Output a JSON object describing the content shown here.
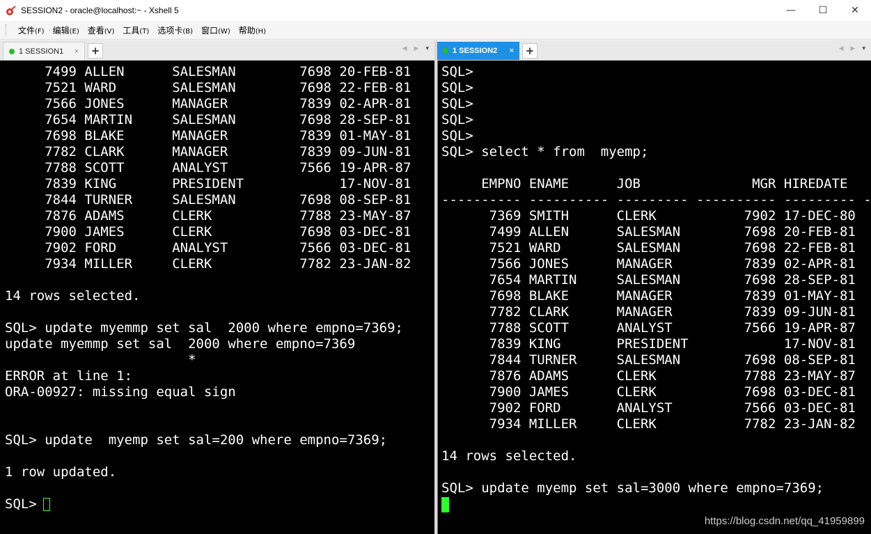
{
  "window": {
    "title": "SESSION2 - oracle@localhost:~ - Xshell 5",
    "minimize": "—",
    "maximize": "☐",
    "close": "✕"
  },
  "menu": [
    {
      "label": "文件",
      "accel": "(F)"
    },
    {
      "label": "编辑",
      "accel": "(E)"
    },
    {
      "label": "查看",
      "accel": "(V)"
    },
    {
      "label": "工具",
      "accel": "(T)"
    },
    {
      "label": "选项卡",
      "accel": "(B)"
    },
    {
      "label": "窗口",
      "accel": "(W)"
    },
    {
      "label": "帮助",
      "accel": "(H)"
    }
  ],
  "left_pane": {
    "tab_label": "1 SESSION1",
    "tab_close": "×",
    "add_tab": "+",
    "nav_prev": "◀",
    "nav_next": "▶",
    "nav_dropdown": "▾",
    "lines": [
      "     7499 ALLEN      SALESMAN        7698 20-FEB-81",
      "     7521 WARD       SALESMAN        7698 22-FEB-81",
      "     7566 JONES      MANAGER         7839 02-APR-81",
      "     7654 MARTIN     SALESMAN        7698 28-SEP-81",
      "     7698 BLAKE      MANAGER         7839 01-MAY-81",
      "     7782 CLARK      MANAGER         7839 09-JUN-81",
      "     7788 SCOTT      ANALYST         7566 19-APR-87",
      "     7839 KING       PRESIDENT            17-NOV-81",
      "     7844 TURNER     SALESMAN        7698 08-SEP-81",
      "     7876 ADAMS      CLERK           7788 23-MAY-87",
      "     7900 JAMES      CLERK           7698 03-DEC-81",
      "     7902 FORD       ANALYST         7566 03-DEC-81",
      "     7934 MILLER     CLERK           7782 23-JAN-82",
      "",
      "14 rows selected.",
      "",
      "SQL> update myemmp set sal  2000 where empno=7369;",
      "update myemmp set sal  2000 where empno=7369",
      "                       *",
      "ERROR at line 1:",
      "ORA-00927: missing equal sign",
      "",
      "",
      "SQL> update  myemp set sal=200 where empno=7369;",
      "",
      "1 row updated.",
      "",
      "SQL> "
    ]
  },
  "right_pane": {
    "tab_label": "1 SESSION2",
    "tab_close": "×",
    "add_tab": "+",
    "nav_prev": "◀",
    "nav_next": "▶",
    "nav_dropdown": "▾",
    "lines": [
      "SQL>",
      "SQL>",
      "SQL>",
      "SQL>",
      "SQL>",
      "SQL> select * from  myemp;",
      "",
      "     EMPNO ENAME      JOB              MGR HIREDATE",
      "---------- ---------- --------- ---------- --------- --",
      "      7369 SMITH      CLERK           7902 17-DEC-80",
      "      7499 ALLEN      SALESMAN        7698 20-FEB-81",
      "      7521 WARD       SALESMAN        7698 22-FEB-81",
      "      7566 JONES      MANAGER         7839 02-APR-81",
      "      7654 MARTIN     SALESMAN        7698 28-SEP-81",
      "      7698 BLAKE      MANAGER         7839 01-MAY-81",
      "      7782 CLARK      MANAGER         7839 09-JUN-81",
      "      7788 SCOTT      ANALYST         7566 19-APR-87",
      "      7839 KING       PRESIDENT            17-NOV-81",
      "      7844 TURNER     SALESMAN        7698 08-SEP-81",
      "      7876 ADAMS      CLERK           7788 23-MAY-87",
      "      7900 JAMES      CLERK           7698 03-DEC-81",
      "      7902 FORD       ANALYST         7566 03-DEC-81",
      "      7934 MILLER     CLERK           7782 23-JAN-82",
      "",
      "14 rows selected.",
      "",
      "SQL> update myemp set sal=3000 where empno=7369;"
    ]
  },
  "watermark": "https://blog.csdn.net/qq_41959899",
  "colors": {
    "active_tab": "#1e90e6",
    "session_dot": "#22c022",
    "cursor": "#2bff2b",
    "terminal_bg": "#000000",
    "terminal_fg": "#ffffff"
  }
}
